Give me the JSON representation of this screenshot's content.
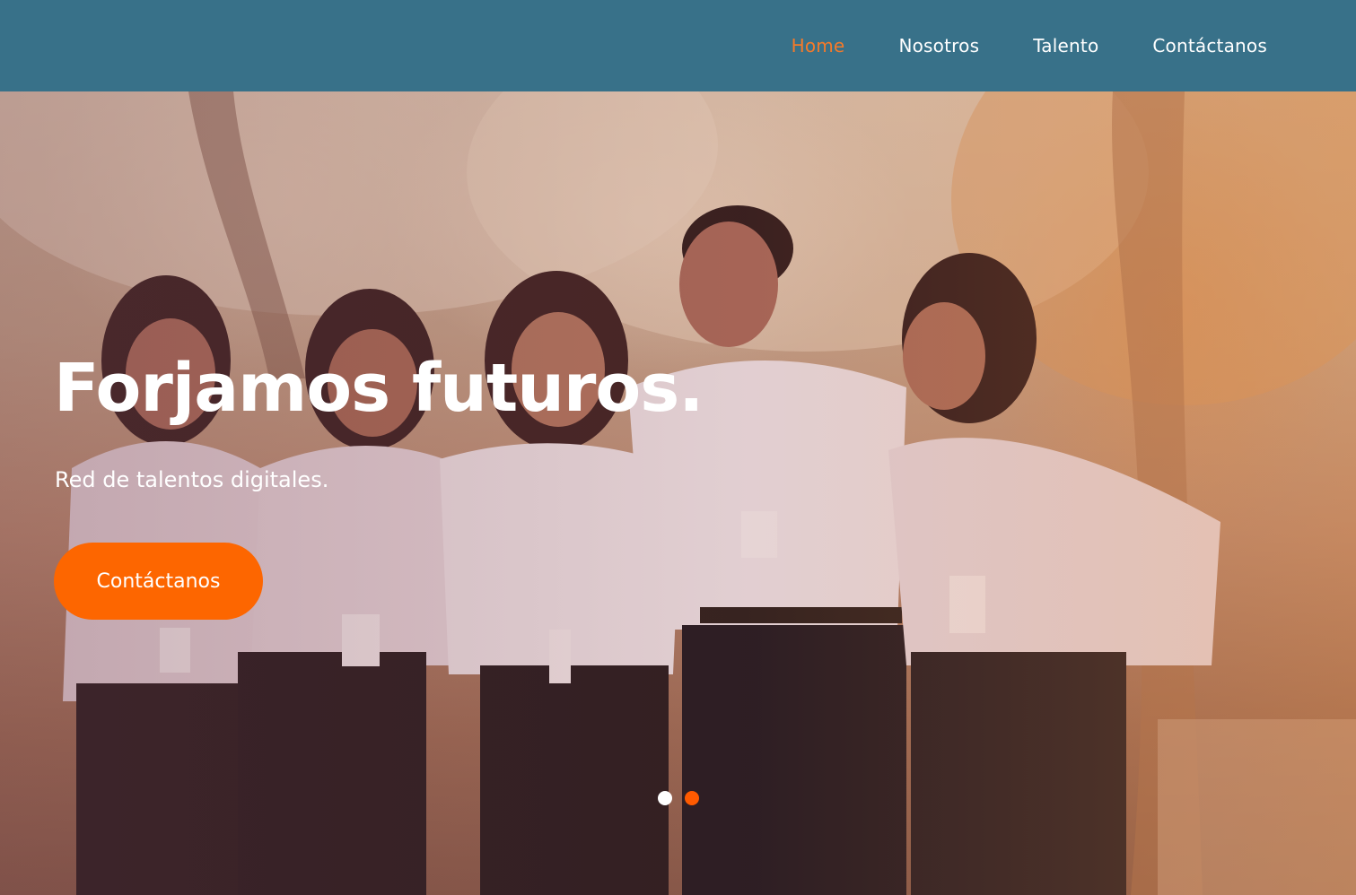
{
  "nav": {
    "items": [
      {
        "label": "Home",
        "active": true
      },
      {
        "label": "Nosotros",
        "active": false
      },
      {
        "label": "Talento",
        "active": false
      },
      {
        "label": "Contáctanos",
        "active": false
      }
    ]
  },
  "hero": {
    "title": "Forjamos futuros.",
    "subtitle": "Red de talentos digitales.",
    "cta_label": "Contáctanos",
    "image_subject": "five smiling people in white shirts with ID lanyards standing arm in arm outdoors",
    "slide_count": 2,
    "active_slide": 2
  },
  "colors": {
    "nav_background": "#387189",
    "nav_active": "#f47a2a",
    "cta_background": "#fd6600",
    "dot_active": "#ff5a00",
    "dot_inactive": "#ffffff"
  }
}
